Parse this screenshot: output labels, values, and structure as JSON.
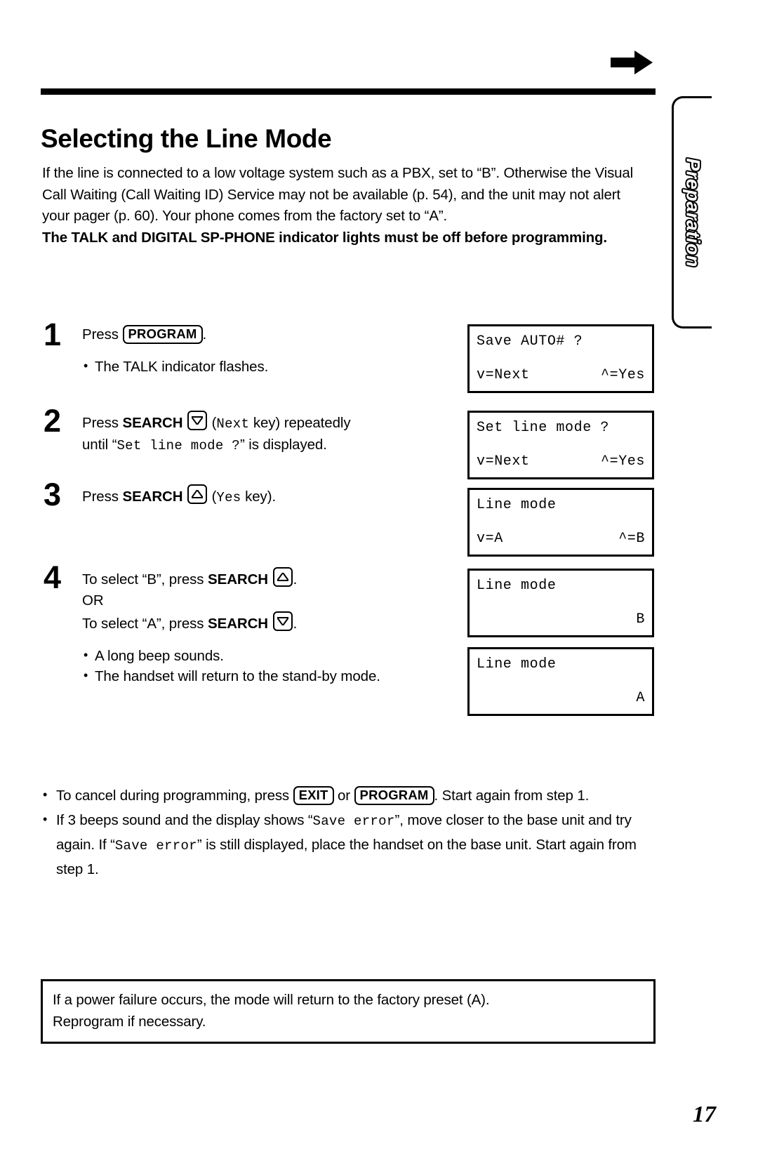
{
  "header": {
    "arrow_icon": "right-arrow-icon",
    "title": "Selecting the Line Mode"
  },
  "side_tab": {
    "label": "Preparation"
  },
  "intro": {
    "paragraph": "If the line is connected to a low voltage system such as a PBX, set to “B”. Otherwise the Visual Call Waiting (Call Waiting ID) Service may not be available (p. 54), and the unit may not alert your pager (p. 60). Your phone comes from the factory set to “A”.",
    "bold_note": "The TALK and DIGITAL SP-PHONE indicator lights must be off before programming."
  },
  "steps": [
    {
      "number": "1",
      "text_before": "Press ",
      "keycap": "PROGRAM",
      "text_after": ".",
      "bullets": [
        "The TALK indicator flashes."
      ]
    },
    {
      "number": "2",
      "line1_before": "Press ",
      "line1_bold": "SEARCH",
      "line1_key": "down-arrow-key",
      "line1_mid": " (",
      "line1_mono": "Next",
      "line1_after": " key) repeatedly",
      "line2_before": "until “",
      "line2_mono": "Set line mode ?",
      "line2_after": "” is displayed."
    },
    {
      "number": "3",
      "text_before": "Press ",
      "bold": "SEARCH",
      "key": "up-arrow-key",
      "mid": " (",
      "mono": "Yes",
      "after": " key)."
    },
    {
      "number": "4",
      "line1_before": "To select “B”, press ",
      "line1_bold": "SEARCH",
      "line1_key": "up-arrow-key",
      "line1_after": ".",
      "line2": "OR",
      "line3_before": "To select “A”, press ",
      "line3_bold": "SEARCH",
      "line3_key": "down-arrow-key",
      "line3_after": ".",
      "bullets": [
        "A long beep sounds.",
        "The handset will return to the stand-by mode."
      ]
    }
  ],
  "lcd_panels": [
    {
      "top_left": "Save AUTO# ?",
      "top_right": "",
      "bottom_left": "v=Next",
      "bottom_right": "^=Yes"
    },
    {
      "top_left": "Set line mode ?",
      "top_right": "",
      "bottom_left": "v=Next",
      "bottom_right": "^=Yes"
    },
    {
      "top_left": "Line mode",
      "top_right": "",
      "bottom_left": "v=A",
      "bottom_right": "^=B"
    },
    {
      "top_left": "Line mode",
      "top_right": "",
      "bottom_left": "",
      "bottom_right": "B"
    },
    {
      "top_left": "Line mode",
      "top_right": "",
      "bottom_left": "",
      "bottom_right": "A"
    }
  ],
  "notes": {
    "bullet1_before": "To cancel during programming, press ",
    "bullet1_key1": "EXIT",
    "bullet1_mid": " or ",
    "bullet1_key2": "PROGRAM",
    "bullet1_after": ". Start again from step 1.",
    "bullet2_before": "If 3 beeps sound and the display shows “",
    "bullet2_mono1": "Save error",
    "bullet2_mid": "”, move closer to the base unit and try again. If “",
    "bullet2_mono2": "Save error",
    "bullet2_after": "” is still displayed, place the handset on the base unit. Start again from step 1."
  },
  "boxnote": {
    "line1": "If a power failure occurs, the mode will return to the factory preset (A).",
    "line2": "Reprogram if necessary."
  },
  "footer": {
    "page_number": "17"
  }
}
